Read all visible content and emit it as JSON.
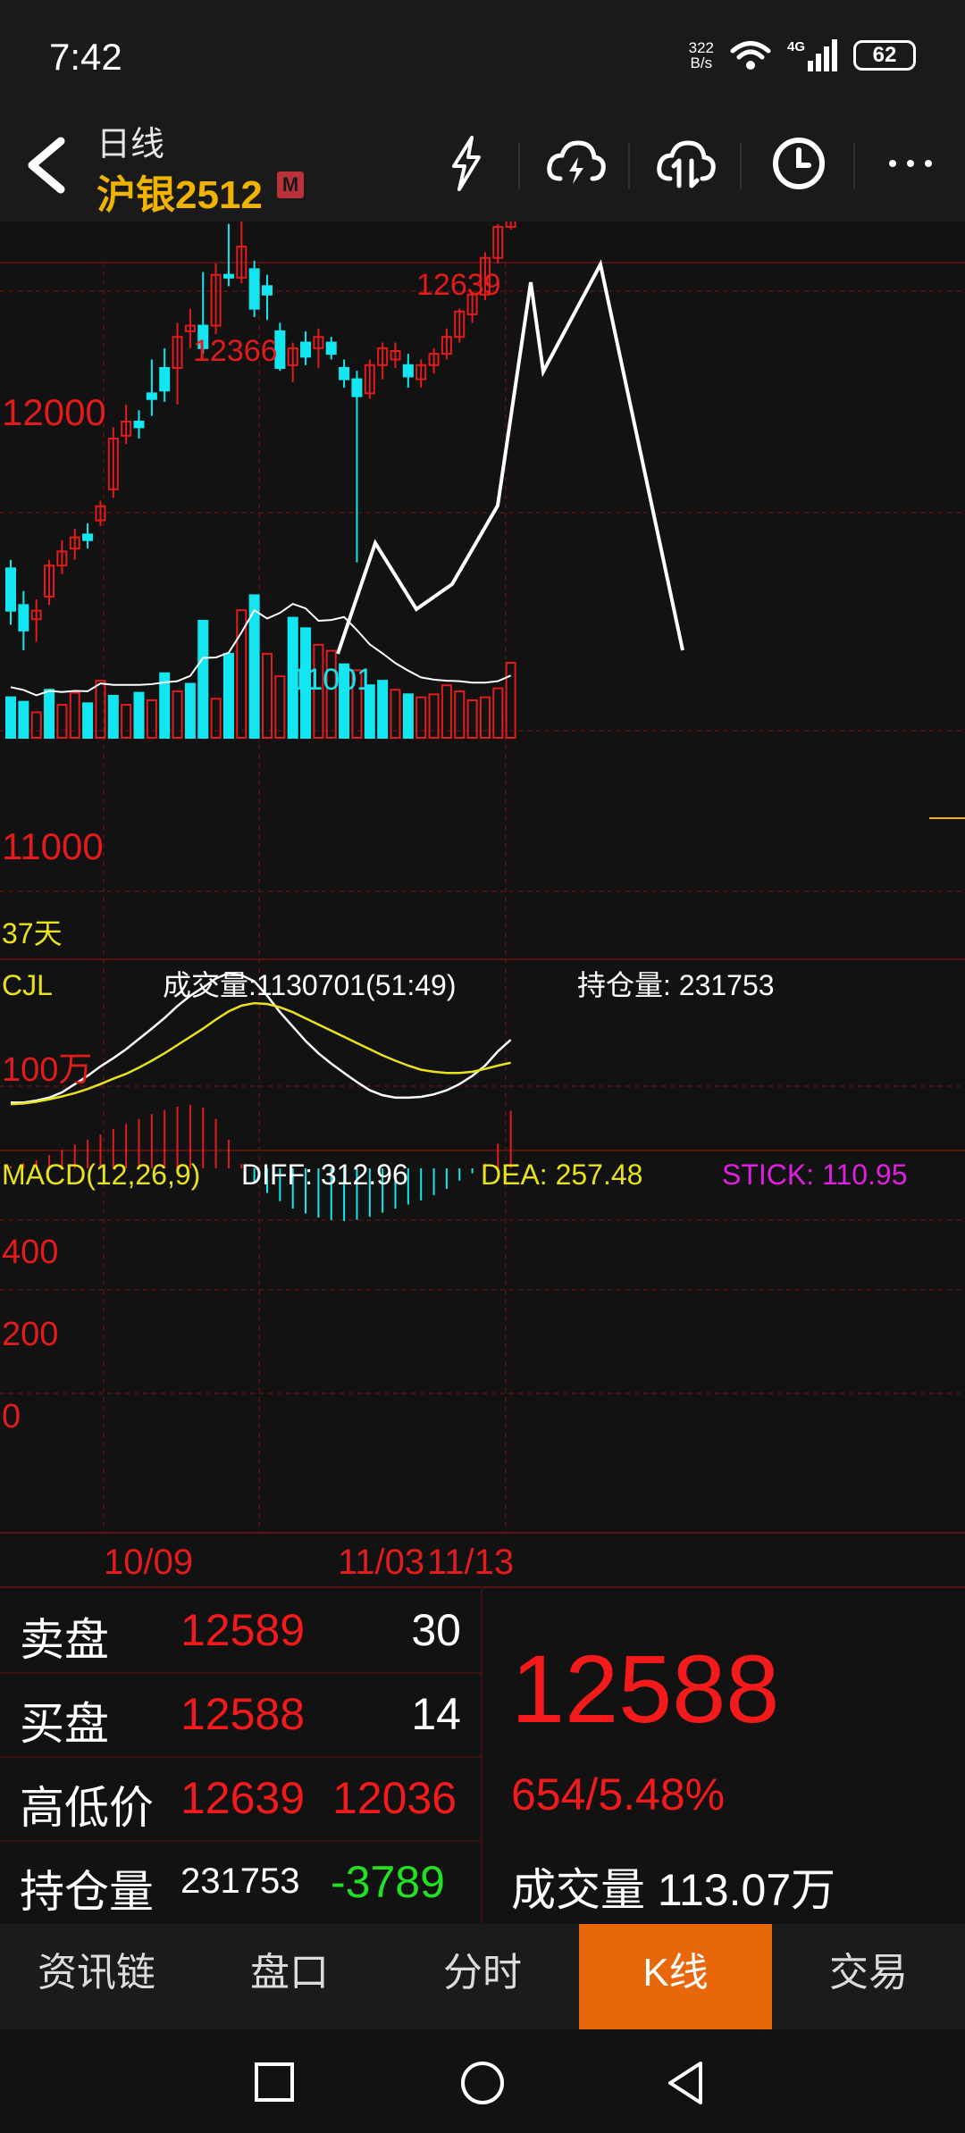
{
  "status_bar": {
    "time": "7:42",
    "net_speed_value": "322",
    "net_speed_unit": "B/s",
    "network_type": "4G",
    "battery": "62"
  },
  "header": {
    "subtitle": "日线",
    "symbol": "沪银2512",
    "badge": "M",
    "icons": [
      "lightning-icon",
      "cloud-lightning-icon",
      "cloud-compare-icon",
      "clock-icon",
      "more-icon"
    ]
  },
  "chart": {
    "price_labels": {
      "high_label": "12639",
      "peak_label": "12366",
      "low_label": "11001",
      "y_level_12000": "12000",
      "y_level_11000": "11000",
      "days_label": "37天"
    },
    "volume": {
      "title": "CJL",
      "volume_text": "成交量:1130701(51:49)",
      "open_interest_text": "持仓量: 231753",
      "scale_label": "100万"
    },
    "macd": {
      "title": "MACD(12,26,9)",
      "diff_text": "DIFF: 312.96",
      "dea_text": "DEA: 257.48",
      "stick_text": "STICK: 110.95",
      "y_labels": [
        "400",
        "200",
        "0"
      ]
    },
    "dates": [
      "10/09",
      "11/03",
      "11/13"
    ]
  },
  "chart_data": {
    "type": "candlestick",
    "title": "沪银2512",
    "current_price": 12588,
    "candles": [
      {
        "o": 10980,
        "h": 11010,
        "l": 10780,
        "c": 10830
      },
      {
        "o": 10850,
        "h": 10900,
        "l": 10690,
        "c": 10760
      },
      {
        "o": 10800,
        "h": 10870,
        "l": 10720,
        "c": 10830
      },
      {
        "o": 10880,
        "h": 11010,
        "l": 10850,
        "c": 10990
      },
      {
        "o": 10990,
        "h": 11080,
        "l": 10960,
        "c": 11040
      },
      {
        "o": 11050,
        "h": 11120,
        "l": 11010,
        "c": 11090
      },
      {
        "o": 11100,
        "h": 11140,
        "l": 11050,
        "c": 11080
      },
      {
        "o": 11150,
        "h": 11220,
        "l": 11130,
        "c": 11200
      },
      {
        "o": 11260,
        "h": 11480,
        "l": 11230,
        "c": 11440
      },
      {
        "o": 11450,
        "h": 11560,
        "l": 11420,
        "c": 11500
      },
      {
        "o": 11500,
        "h": 11540,
        "l": 11440,
        "c": 11480
      },
      {
        "o": 11600,
        "h": 11720,
        "l": 11520,
        "c": 11580
      },
      {
        "o": 11690,
        "h": 11760,
        "l": 11570,
        "c": 11610
      },
      {
        "o": 11690,
        "h": 11850,
        "l": 11560,
        "c": 11800
      },
      {
        "o": 11820,
        "h": 11900,
        "l": 11760,
        "c": 11840
      },
      {
        "o": 11840,
        "h": 12030,
        "l": 11740,
        "c": 11760
      },
      {
        "o": 11840,
        "h": 12060,
        "l": 11810,
        "c": 12020
      },
      {
        "o": 12020,
        "h": 12200,
        "l": 11980,
        "c": 12010
      },
      {
        "o": 12010,
        "h": 12366,
        "l": 11990,
        "c": 12120
      },
      {
        "o": 12040,
        "h": 12070,
        "l": 11870,
        "c": 11900
      },
      {
        "o": 11980,
        "h": 12020,
        "l": 11860,
        "c": 11950
      },
      {
        "o": 11820,
        "h": 11850,
        "l": 11680,
        "c": 11690
      },
      {
        "o": 11700,
        "h": 11780,
        "l": 11640,
        "c": 11760
      },
      {
        "o": 11780,
        "h": 11820,
        "l": 11700,
        "c": 11730
      },
      {
        "o": 11760,
        "h": 11830,
        "l": 11690,
        "c": 11800
      },
      {
        "o": 11780,
        "h": 11800,
        "l": 11720,
        "c": 11740
      },
      {
        "o": 11690,
        "h": 11720,
        "l": 11620,
        "c": 11650
      },
      {
        "o": 11650,
        "h": 11680,
        "l": 11001,
        "c": 11590
      },
      {
        "o": 11600,
        "h": 11720,
        "l": 11580,
        "c": 11700
      },
      {
        "o": 11700,
        "h": 11780,
        "l": 11650,
        "c": 11760
      },
      {
        "o": 11720,
        "h": 11780,
        "l": 11690,
        "c": 11750
      },
      {
        "o": 11700,
        "h": 11740,
        "l": 11620,
        "c": 11660
      },
      {
        "o": 11650,
        "h": 11720,
        "l": 11620,
        "c": 11700
      },
      {
        "o": 11700,
        "h": 11760,
        "l": 11670,
        "c": 11740
      },
      {
        "o": 11740,
        "h": 11830,
        "l": 11720,
        "c": 11800
      },
      {
        "o": 11800,
        "h": 11900,
        "l": 11780,
        "c": 11890
      },
      {
        "o": 11880,
        "h": 11960,
        "l": 11850,
        "c": 11950
      },
      {
        "o": 11950,
        "h": 12100,
        "l": 11930,
        "c": 12080
      },
      {
        "o": 12080,
        "h": 12200,
        "l": 12060,
        "c": 12190
      },
      {
        "o": 12190,
        "h": 12639,
        "l": 12180,
        "c": 12588
      }
    ],
    "volume_bars": [
      0.27,
      0.24,
      0.17,
      0.32,
      0.22,
      0.3,
      0.23,
      0.38,
      0.28,
      0.22,
      0.3,
      0.25,
      0.43,
      0.31,
      0.36,
      0.78,
      0.26,
      0.56,
      0.85,
      0.95,
      0.56,
      0.41,
      0.8,
      0.73,
      0.62,
      0.58,
      0.49,
      0.45,
      0.35,
      0.38,
      0.32,
      0.29,
      0.27,
      0.29,
      0.35,
      0.31,
      0.25,
      0.27,
      0.33,
      0.5
    ],
    "volume_colors": [
      "c",
      "c",
      "r",
      "c",
      "r",
      "r",
      "c",
      "r",
      "c",
      "r",
      "c",
      "r",
      "c",
      "r",
      "c",
      "c",
      "r",
      "c",
      "r",
      "c",
      "r",
      "r",
      "c",
      "c",
      "r",
      "r",
      "c",
      "r",
      "c",
      "c",
      "r",
      "c",
      "r",
      "r",
      "r",
      "r",
      "r",
      "r",
      "r",
      "r"
    ],
    "macd_hist": [
      5,
      12,
      20,
      32,
      45,
      58,
      70,
      82,
      96,
      108,
      120,
      132,
      142,
      150,
      155,
      148,
      120,
      70,
      10,
      -35,
      -60,
      -80,
      -98,
      -110,
      -120,
      -126,
      -128,
      -125,
      -118,
      -108,
      -98,
      -88,
      -78,
      -65,
      -50,
      -30,
      -12,
      12,
      60,
      140
    ],
    "diff": [
      160,
      160,
      165,
      172,
      185,
      205,
      225,
      248,
      268,
      290,
      315,
      340,
      366,
      395,
      420,
      440,
      462,
      475,
      470,
      455,
      420,
      380,
      345,
      310,
      280,
      255,
      232,
      210,
      190,
      178,
      172,
      172,
      174,
      180,
      190,
      205,
      225,
      250,
      285,
      313
    ],
    "dea": [
      156,
      158,
      162,
      168,
      175,
      183,
      193,
      205,
      218,
      230,
      245,
      262,
      280,
      300,
      320,
      340,
      362,
      382,
      396,
      402,
      400,
      392,
      380,
      365,
      350,
      335,
      320,
      305,
      290,
      275,
      262,
      250,
      240,
      235,
      232,
      232,
      235,
      242,
      250,
      257
    ],
    "macd_ylim": [
      -160,
      500
    ]
  },
  "quote": {
    "ask_label": "卖盘",
    "ask_price": "12589",
    "ask_qty": "30",
    "bid_label": "买盘",
    "bid_price": "12588",
    "bid_qty": "14",
    "hl_label": "高低价",
    "high": "12639",
    "low": "12036",
    "oi_label": "持仓量",
    "oi_value": "231753",
    "oi_change": "-3789",
    "last_price": "12588",
    "change": "654/5.48%",
    "volume_label": "成交量",
    "volume_value": "113.07万"
  },
  "tabs": [
    {
      "label": "资讯链"
    },
    {
      "label": "盘口"
    },
    {
      "label": "分时"
    },
    {
      "label": "K线",
      "active": true
    },
    {
      "label": "交易"
    }
  ],
  "colors": {
    "up": "#e21b1b",
    "down": "#12e6f0",
    "accent": "#f0b400",
    "tab_active": "#e8670b"
  }
}
